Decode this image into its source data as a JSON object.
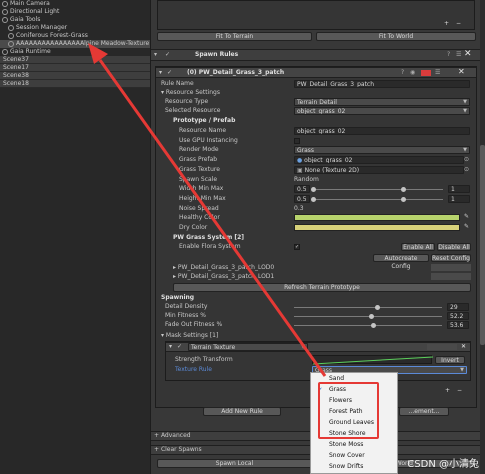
{
  "hierarchy": {
    "items": [
      {
        "label": "Main Camera"
      },
      {
        "label": "Directional Light"
      },
      {
        "label": "Gaia Tools"
      },
      {
        "label": "Session Manager"
      },
      {
        "label": "Coniferous Forest-Grass"
      },
      {
        "label": "AAAAAAAAAAAAAAAAlpine Meadow-Texture"
      },
      {
        "label": "Gaia Runtime"
      }
    ],
    "scenes": [
      "Scene37",
      "Scene17",
      "Scene38",
      "Scene18"
    ]
  },
  "inspector": {
    "fit_to_terrain": "Fit To Terrain",
    "fit_to_world": "Fit To World",
    "spawn_rules": "Spawn Rules",
    "rule_header": "(0) PW_Detail_Grass_3_patch",
    "rule_name_label": "Rule Name",
    "rule_name_value": "PW_Detail_Grass_3_patch",
    "resource_settings": "Resource Settings",
    "resource_type_label": "Resource Type",
    "resource_type_value": "Terrain Detail",
    "selected_resource_label": "Selected Resource",
    "selected_resource_value": "object_grass_02",
    "prototype_prefab": "Prototype / Prefab",
    "resource_name_label": "Resource Name",
    "resource_name_value": "object_grass_02",
    "use_gpu_label": "Use GPU Instancing",
    "render_mode_label": "Render Mode",
    "render_mode_value": "Grass",
    "grass_prefab_label": "Grass Prefab",
    "grass_prefab_value": "object_grass_02",
    "grass_texture_label": "Grass Texture",
    "grass_texture_value": "None (Texture 2D)",
    "spawn_scale_label": "Spawn Scale",
    "spawn_scale_value": "Random",
    "width_min_max_label": "Width Min Max",
    "width_min": "0.5",
    "width_max": "1",
    "height_min_max_label": "Height Min Max",
    "height_min": "0.5",
    "height_max": "1",
    "noise_spread_label": "Noise Spread",
    "noise_spread_value": "0.3",
    "healthy_color_label": "Healthy Color",
    "dry_color_label": "Dry Color",
    "grass_system_label": "PW Grass System",
    "grass_system_count": "[2]",
    "enable_flora_label": "Enable Flora System",
    "enable_all": "Enable All",
    "disable_all": "Disable All",
    "autocreate_config": "Autocreate Config",
    "reset_config": "Reset Config",
    "lod0": "PW_Detail_Grass_3_patch_LOD0",
    "lod1": "PW_Detail_Grass_3_patch_LOD1",
    "refresh_prototype": "Refresh Terrain Prototype",
    "spawning": "Spawning",
    "detail_density_label": "Detail Density",
    "detail_density_value": "29",
    "min_fitness_label": "Min Fitness %",
    "min_fitness_value": "52.2",
    "fade_out_label": "Fade Out Fitness %",
    "fade_out_value": "53.6",
    "mask_settings": "Mask Settings [1]",
    "mask_type_value": "Terrain Texture",
    "strength_transform_label": "Strength Transform",
    "invert_label": "Invert",
    "texture_rule_label": "Texture Rule",
    "texture_rule_value": "Grass",
    "add_new_rule": "Add New Rule",
    "other_button_partial": "...ement...",
    "advanced": "Advanced",
    "clear_spawns": "Clear Spawns",
    "spawn_local": "Spawn Local",
    "world_partial": "World",
    "plus": "+",
    "minus": "−"
  },
  "popup": {
    "items": [
      "Sand",
      "Grass",
      "Flowers",
      "Forest Path",
      "Ground Leaves",
      "Stone Shore",
      "Stone Moss",
      "Snow Cover",
      "Snow Drifts"
    ],
    "selected": "Grass",
    "check": "✓"
  },
  "watermark": "CSDN @小清兔",
  "colors": {
    "healthy": "#b7d36c",
    "dry": "#d7d17a",
    "arrow": "#e53935",
    "highlight_box": "#e53935"
  }
}
